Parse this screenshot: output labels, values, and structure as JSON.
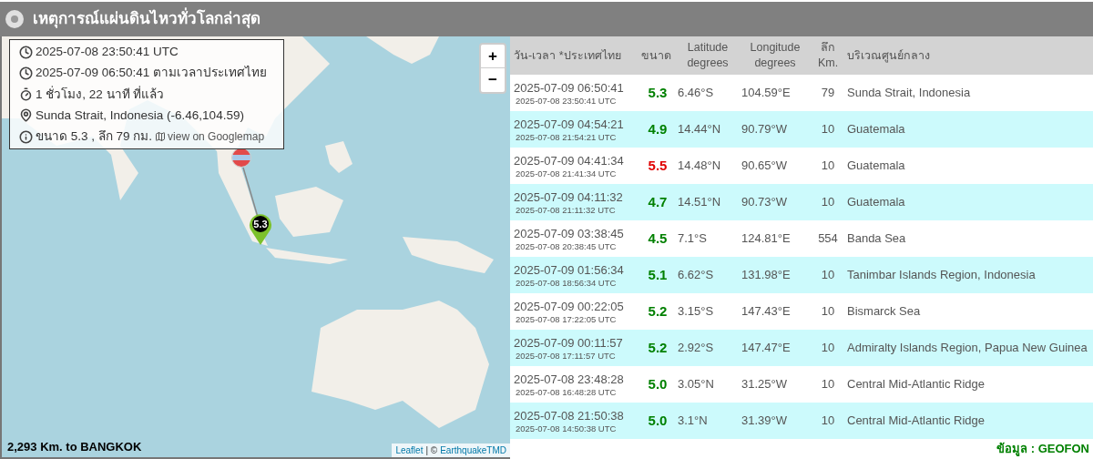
{
  "header": {
    "title": "เหตุการณ์แผ่นดินไหวทั่วโลกล่าสุด"
  },
  "map": {
    "info": [
      {
        "kind": "utc_time",
        "text": "2025-07-08 23:50:41 UTC"
      },
      {
        "kind": "local_time",
        "text": "2025-07-09 06:50:41 ตามเวลาประเทศไทย"
      },
      {
        "kind": "elapsed",
        "text": "1 ชั่วโมง, 22 นาที ที่แล้ว"
      },
      {
        "kind": "location",
        "text": "Sunda Strait, Indonesia (-6.46,104.59)"
      },
      {
        "kind": "magnitude",
        "text": "ขนาด 5.3 , ลึก 79 กม.",
        "link": "view on Googlemap"
      }
    ],
    "zoom": [
      "+",
      "−"
    ],
    "marker": {
      "label": "5.3"
    },
    "distance": "2,293 Km. to BANGKOK",
    "attribution": {
      "first": "Leaflet",
      "separator": "| ©",
      "second": "EarthquakeTMD"
    }
  },
  "table": {
    "columns": [
      [
        "วัน-เวลา *ประเทศไทย"
      ],
      [
        "ขนาด"
      ],
      [
        "Latitude",
        "degrees"
      ],
      [
        "Longitude",
        "degrees"
      ],
      [
        "ลึก",
        "Km."
      ],
      [
        "บริเวณศูนย์กลาง"
      ]
    ],
    "rows": [
      {
        "local": "2025-07-09 06:50:41",
        "utc": "2025-07-08 23:50:41 UTC",
        "magnitude": "5.3",
        "color": "#008000",
        "lat": "6.46°S",
        "lon": "104.59°E",
        "depth": "79",
        "region": "Sunda Strait, Indonesia"
      },
      {
        "local": "2025-07-09 04:54:21",
        "utc": "2025-07-08 21:54:21 UTC",
        "magnitude": "4.9",
        "color": "#008000",
        "lat": "14.44°N",
        "lon": "90.79°W",
        "depth": "10",
        "region": "Guatemala"
      },
      {
        "local": "2025-07-09 04:41:34",
        "utc": "2025-07-08 21:41:34 UTC",
        "magnitude": "5.5",
        "color": "#e00000",
        "lat": "14.48°N",
        "lon": "90.65°W",
        "depth": "10",
        "region": "Guatemala"
      },
      {
        "local": "2025-07-09 04:11:32",
        "utc": "2025-07-08 21:11:32 UTC",
        "magnitude": "4.7",
        "color": "#008000",
        "lat": "14.51°N",
        "lon": "90.73°W",
        "depth": "10",
        "region": "Guatemala"
      },
      {
        "local": "2025-07-09 03:38:45",
        "utc": "2025-07-08 20:38:45 UTC",
        "magnitude": "4.5",
        "color": "#008000",
        "lat": "7.1°S",
        "lon": "124.81°E",
        "depth": "554",
        "region": "Banda Sea"
      },
      {
        "local": "2025-07-09 01:56:34",
        "utc": "2025-07-08 18:56:34 UTC",
        "magnitude": "5.1",
        "color": "#008000",
        "lat": "6.62°S",
        "lon": "131.98°E",
        "depth": "10",
        "region": "Tanimbar Islands Region, Indonesia"
      },
      {
        "local": "2025-07-09 00:22:05",
        "utc": "2025-07-08 17:22:05 UTC",
        "magnitude": "5.2",
        "color": "#008000",
        "lat": "3.15°S",
        "lon": "147.43°E",
        "depth": "10",
        "region": "Bismarck Sea"
      },
      {
        "local": "2025-07-09 00:11:57",
        "utc": "2025-07-08 17:11:57 UTC",
        "magnitude": "5.2",
        "color": "#008000",
        "lat": "2.92°S",
        "lon": "147.47°E",
        "depth": "10",
        "region": "Admiralty Islands Region, Papua New Guinea"
      },
      {
        "local": "2025-07-08 23:48:28",
        "utc": "2025-07-08 16:48:28 UTC",
        "magnitude": "5.0",
        "color": "#008000",
        "lat": "3.05°N",
        "lon": "31.25°W",
        "depth": "10",
        "region": "Central Mid-Atlantic Ridge"
      },
      {
        "local": "2025-07-08 21:50:38",
        "utc": "2025-07-08 14:50:38 UTC",
        "magnitude": "5.0",
        "color": "#008000",
        "lat": "3.1°N",
        "lon": "31.39°W",
        "depth": "10",
        "region": "Central Mid-Atlantic Ridge"
      }
    ]
  },
  "source": "ข้อมูล : GEOFON"
}
